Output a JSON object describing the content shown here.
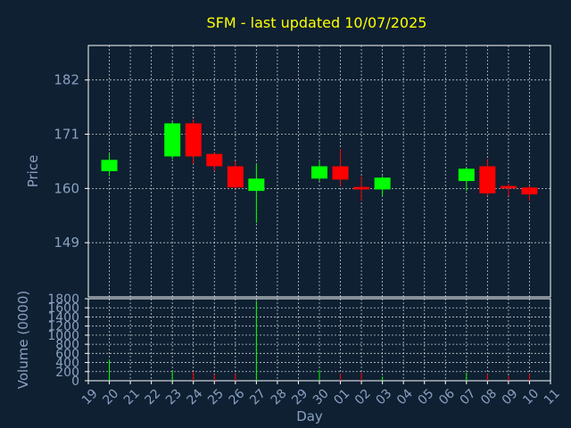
{
  "chart_data": {
    "type": "candlestick",
    "title": "SFM - last updated 10/07/2025",
    "xlabel": "Day",
    "price_ylabel": "Price",
    "volume_ylabel": "Volume (0000)",
    "x_tick_labels": [
      "19",
      "20",
      "21",
      "22",
      "23",
      "24",
      "25",
      "26",
      "27",
      "28",
      "29",
      "30",
      "01",
      "02",
      "03",
      "04",
      "05",
      "06",
      "07",
      "08",
      "09",
      "10",
      "11"
    ],
    "price_ylim": [
      138,
      189
    ],
    "price_ticks": [
      149,
      160,
      171,
      182
    ],
    "volume_ylim": [
      0,
      1800
    ],
    "volume_ticks": [
      0,
      200,
      400,
      600,
      800,
      1000,
      1200,
      1400,
      1600,
      1800
    ],
    "grid": true,
    "colors": {
      "up": "#00ff00",
      "down": "#ff0000",
      "title": "#ffff00",
      "axis_text": "#8aa0c0",
      "background": "#0e2032"
    },
    "candles": [
      {
        "day": "20",
        "idx": 1,
        "open": 163.5,
        "close": 165.8,
        "high": 167.0,
        "low": 162.5,
        "volume": 470
      },
      {
        "day": "23",
        "idx": 4,
        "open": 166.5,
        "close": 173.2,
        "high": 173.5,
        "low": 166.0,
        "volume": 220
      },
      {
        "day": "24",
        "idx": 5,
        "open": 173.2,
        "close": 166.5,
        "high": 174.0,
        "low": 165.0,
        "volume": 200
      },
      {
        "day": "25",
        "idx": 6,
        "open": 167.0,
        "close": 164.5,
        "high": 167.2,
        "low": 163.5,
        "volume": 140
      },
      {
        "day": "26",
        "idx": 7,
        "open": 164.5,
        "close": 160.2,
        "high": 165.5,
        "low": 160.0,
        "volume": 150
      },
      {
        "day": "27",
        "idx": 8,
        "open": 159.5,
        "close": 162.0,
        "high": 165.0,
        "low": 153.0,
        "volume": 1750
      },
      {
        "day": "30",
        "idx": 11,
        "open": 162.0,
        "close": 164.5,
        "high": 165.5,
        "low": 161.5,
        "volume": 240
      },
      {
        "day": "01",
        "idx": 12,
        "open": 164.5,
        "close": 161.8,
        "high": 168.0,
        "low": 160.5,
        "volume": 160
      },
      {
        "day": "02",
        "idx": 13,
        "open": 160.3,
        "close": 159.8,
        "high": 162.5,
        "low": 157.5,
        "volume": 180
      },
      {
        "day": "03",
        "idx": 14,
        "open": 159.8,
        "close": 162.2,
        "high": 162.5,
        "low": 158.5,
        "volume": 90
      },
      {
        "day": "07",
        "idx": 18,
        "open": 161.5,
        "close": 164.0,
        "high": 164.2,
        "low": 159.5,
        "volume": 180
      },
      {
        "day": "08",
        "idx": 19,
        "open": 164.5,
        "close": 159.0,
        "high": 166.0,
        "low": 158.5,
        "volume": 150
      },
      {
        "day": "09",
        "idx": 20,
        "open": 160.5,
        "close": 160.0,
        "high": 161.0,
        "low": 158.5,
        "volume": 110
      },
      {
        "day": "10",
        "idx": 21,
        "open": 160.2,
        "close": 158.8,
        "high": 160.5,
        "low": 157.5,
        "volume": 150
      }
    ]
  }
}
